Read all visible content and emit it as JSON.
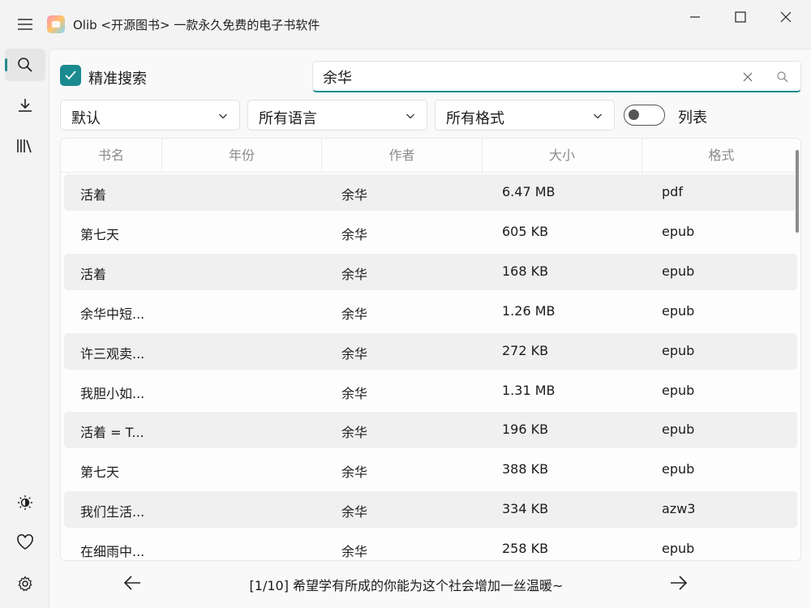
{
  "window": {
    "title": "Olib <开源图书> 一款永久免费的电子书软件"
  },
  "sidebar": {
    "items": [
      {
        "name": "search",
        "icon": "search-icon",
        "active": true
      },
      {
        "name": "downloads",
        "icon": "download-icon",
        "active": false
      },
      {
        "name": "library",
        "icon": "library-icon",
        "active": false
      },
      {
        "name": "theme",
        "icon": "brightness-icon",
        "active": false
      },
      {
        "name": "favorites",
        "icon": "heart-icon",
        "active": false
      },
      {
        "name": "settings",
        "icon": "gear-icon",
        "active": false
      }
    ]
  },
  "search": {
    "exact_label": "精准搜索",
    "exact_checked": true,
    "query": "余华",
    "placeholder": ""
  },
  "filters": {
    "sort": "默认",
    "language": "所有语言",
    "format": "所有格式",
    "list_toggle_label": "列表",
    "list_toggle_on": false
  },
  "table": {
    "headers": {
      "name": "书名",
      "year": "年份",
      "author": "作者",
      "size": "大小",
      "format": "格式"
    },
    "rows": [
      {
        "name": "活着",
        "year": "",
        "author": "余华",
        "size": "6.47 MB",
        "format": "pdf"
      },
      {
        "name": "第七天",
        "year": "",
        "author": "余华",
        "size": "605 KB",
        "format": "epub"
      },
      {
        "name": "活着",
        "year": "",
        "author": "余华",
        "size": "168 KB",
        "format": "epub"
      },
      {
        "name": "余华中短...",
        "year": "",
        "author": "余华",
        "size": "1.26 MB",
        "format": "epub"
      },
      {
        "name": "许三观卖...",
        "year": "",
        "author": "余华",
        "size": "272 KB",
        "format": "epub"
      },
      {
        "name": "我胆小如...",
        "year": "",
        "author": "余华",
        "size": "1.31 MB",
        "format": "epub"
      },
      {
        "name": "活着 = T...",
        "year": "",
        "author": "余华",
        "size": "196 KB",
        "format": "epub"
      },
      {
        "name": "第七天",
        "year": "",
        "author": "余华",
        "size": "388 KB",
        "format": "epub"
      },
      {
        "name": "我们生活...",
        "year": "",
        "author": "余华",
        "size": "334 KB",
        "format": "azw3"
      },
      {
        "name": "在细雨中...",
        "year": "",
        "author": "余华",
        "size": "258 KB",
        "format": "epub"
      }
    ]
  },
  "footer": {
    "message": "[1/10] 希望学有所成的你能为这个社会增加一丝温暖~"
  },
  "colors": {
    "accent": "#1a8a8f",
    "row_shade": "#f0f0f0"
  }
}
